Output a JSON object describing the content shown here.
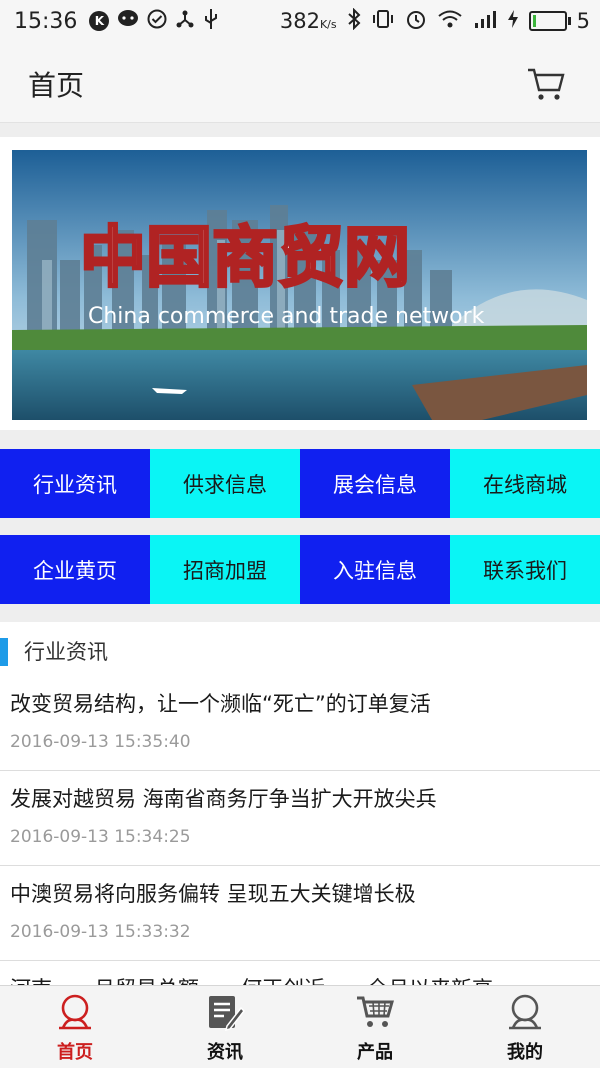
{
  "status_bar": {
    "time": "15:36",
    "speed_value": "382",
    "speed_unit": "K/s",
    "battery_level": "5",
    "icons": [
      "k-app-icon",
      "wechat-icon",
      "check-circle-icon",
      "share-icon",
      "usb-icon",
      "bluetooth-icon",
      "vibrate-icon",
      "alarm-icon",
      "wifi-icon",
      "signal-icon",
      "charging-icon",
      "battery-icon"
    ]
  },
  "header": {
    "title": "首页",
    "cart_icon": "cart-icon"
  },
  "banner": {
    "title": "中国商贸网",
    "subtitle": "China commerce and trade network"
  },
  "nav": {
    "row1": [
      {
        "label": "行业资讯",
        "color": "blue"
      },
      {
        "label": "供求信息",
        "color": "cyan"
      },
      {
        "label": "展会信息",
        "color": "blue"
      },
      {
        "label": "在线商城",
        "color": "cyan"
      }
    ],
    "row2": [
      {
        "label": "企业黄页",
        "color": "blue"
      },
      {
        "label": "招商加盟",
        "color": "cyan"
      },
      {
        "label": "入驻信息",
        "color": "blue"
      },
      {
        "label": "联系我们",
        "color": "cyan"
      }
    ]
  },
  "section": {
    "title": "行业资讯"
  },
  "news": [
    {
      "title": "改变贸易结构，让一个濒临“死亡”的订单复活",
      "time": "2016-09-13 15:35:40"
    },
    {
      "title": "发展对越贸易 海南省商务厅争当扩大开放尖兵",
      "time": "2016-09-13 15:34:25"
    },
    {
      "title": "中澳贸易将向服务偏转 呈现五大关键增长极",
      "time": "2016-09-13 15:33:32"
    },
    {
      "title": "河南一一月贸易总额……何正创近……全月以来新高",
      "time": ""
    }
  ],
  "tabs": [
    {
      "label": "首页",
      "icon": "home-person-icon",
      "active": true
    },
    {
      "label": "资讯",
      "icon": "news-edit-icon",
      "active": false
    },
    {
      "label": "产品",
      "icon": "cart-icon",
      "active": false
    },
    {
      "label": "我的",
      "icon": "user-icon",
      "active": false
    }
  ],
  "colors": {
    "nav_blue": "#1020f0",
    "nav_cyan": "#0af5f5",
    "section_accent": "#1e9be8",
    "active_tab": "#cc1f1f"
  }
}
